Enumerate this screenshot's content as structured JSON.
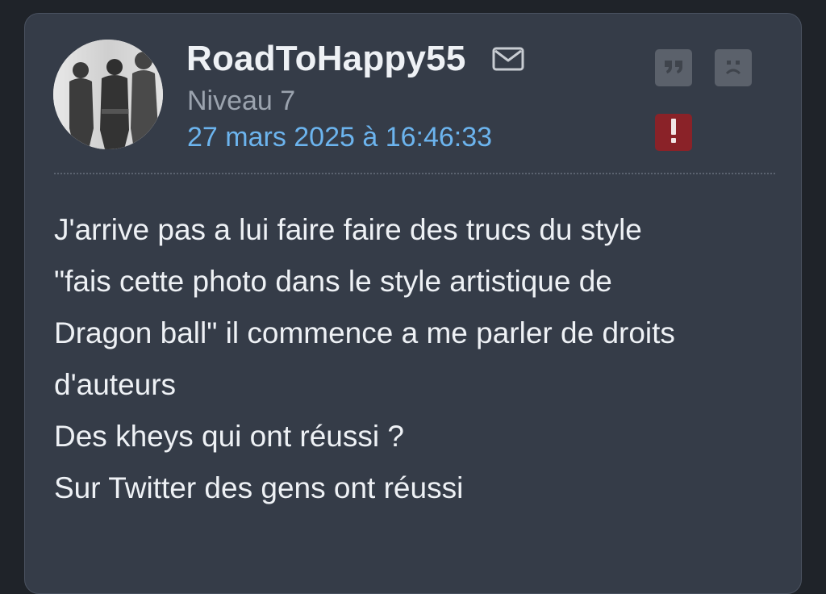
{
  "post": {
    "username": "RoadToHappy55",
    "level": "Niveau 7",
    "date": "27 mars 2025 à 16:46:33",
    "icons": {
      "avatar": "avatar-silhouettes",
      "mail": "envelope-icon",
      "quote": "quote-icon",
      "sad": "sad-face-icon",
      "alert": "exclamation-icon"
    },
    "message_lines": [
      "J'arrive pas a lui faire faire des trucs du style",
      "\"fais cette photo dans le style artistique de",
      "Dragon ball\" il commence a me parler de droits",
      "d'auteurs",
      "Des kheys qui ont réussi ?",
      "Sur Twitter des gens ont réussi"
    ]
  },
  "colors": {
    "card_bg": "#353c48",
    "username": "#eef1f5",
    "level": "#9ba3ae",
    "date": "#6cb4ee",
    "alert_bg": "#8a2228",
    "button_bg": "#5b616b"
  }
}
